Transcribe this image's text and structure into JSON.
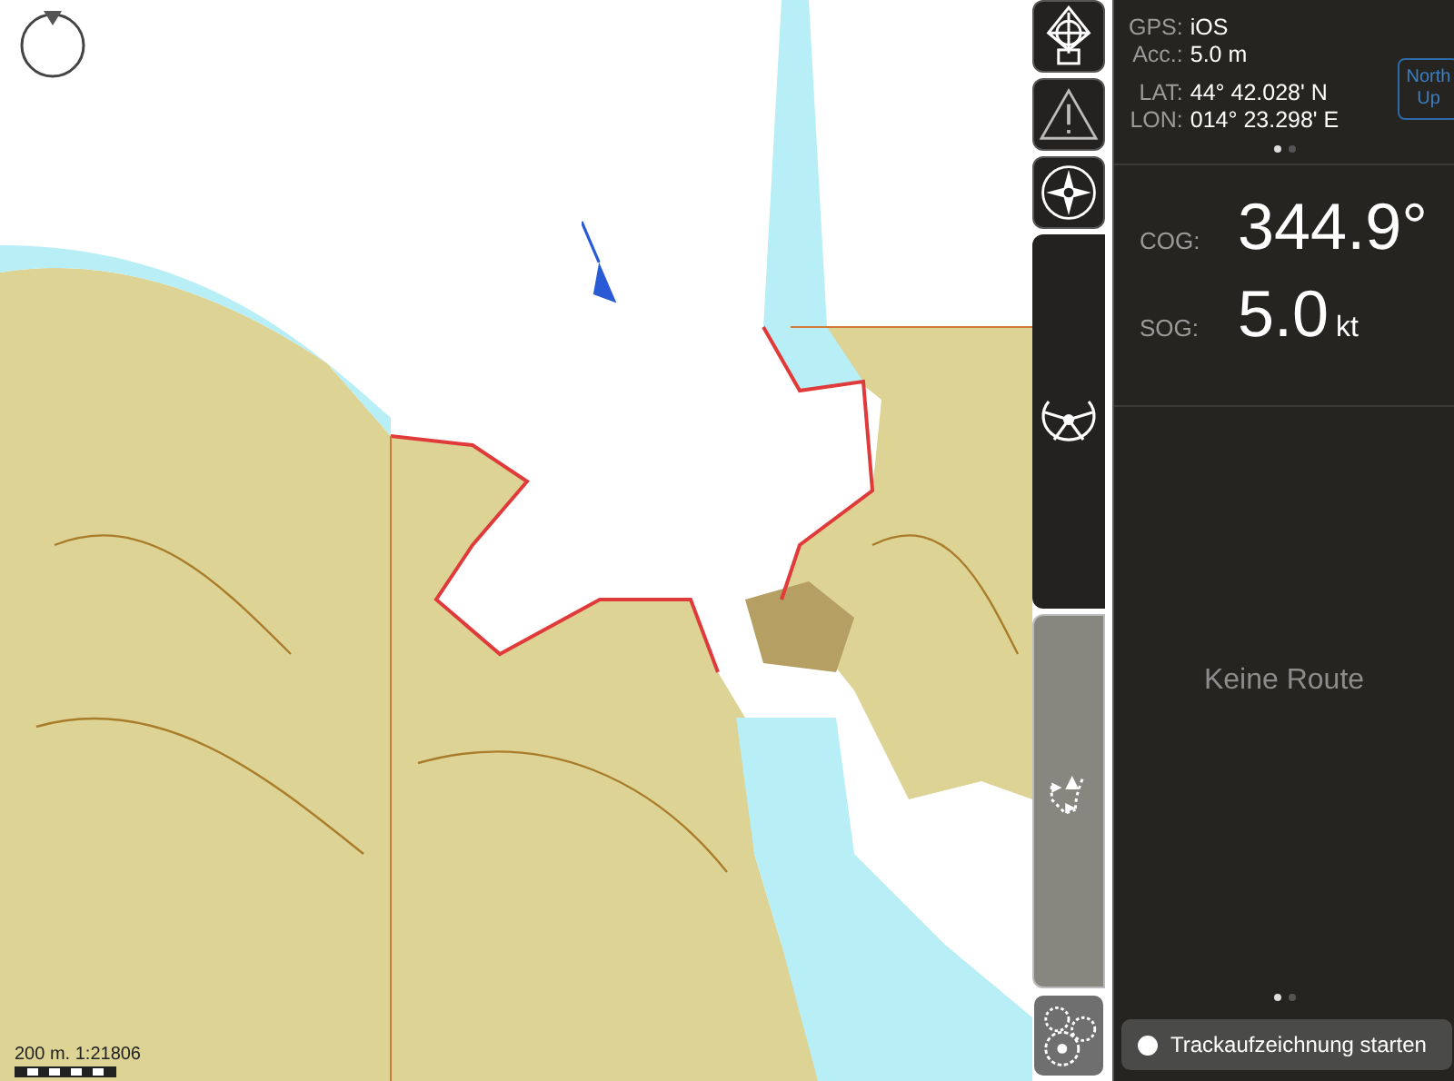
{
  "map": {
    "scale": "200 m. 1:21806"
  },
  "toolbar": [
    {
      "kind": "crosshair"
    },
    {
      "kind": "warning"
    },
    {
      "kind": "compass"
    },
    {
      "kind": "steering"
    },
    {
      "kind": "route"
    },
    {
      "kind": "gears"
    }
  ],
  "gps": {
    "source_label": "GPS:",
    "source": "iOS",
    "accuracy_label": "Acc.:",
    "accuracy": "5.0 m",
    "lat_label": "LAT:",
    "lat": "44° 42.028' N",
    "lon_label": "LON:",
    "lon": "014° 23.298' E",
    "north_up_button": "North Up",
    "pages": [
      {
        "selected": true
      },
      {
        "selected": false
      }
    ]
  },
  "motion": {
    "cog_label": "COG:",
    "cog": "344.9°",
    "sog_label": "SOG:",
    "sog": "5.0",
    "sog_unit": "kt"
  },
  "route": {
    "message": "Keine Route",
    "pages": [
      {
        "selected": true
      },
      {
        "selected": false
      }
    ]
  },
  "track_button": "Trackaufzeichnung starten"
}
